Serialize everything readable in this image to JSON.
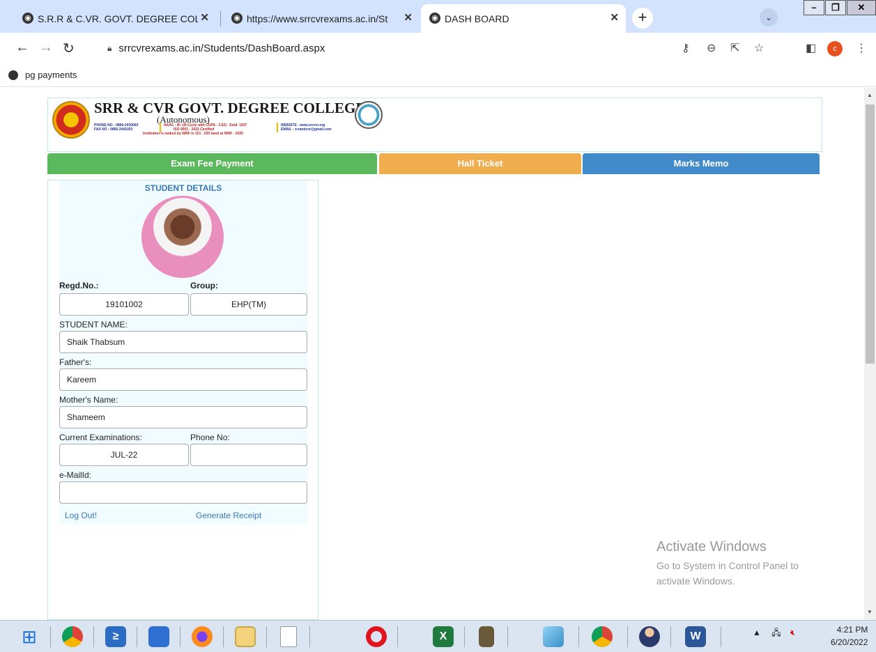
{
  "browser": {
    "tabs": [
      {
        "title": "S.R.R & C.VR. GOVT. DEGREE COL",
        "active": false
      },
      {
        "title": "https://www.srrcvrexams.ac.in/St",
        "active": false
      },
      {
        "title": "DASH BOARD",
        "active": true
      }
    ],
    "url": "srrcvrexams.ac.in/Students/DashBoard.aspx",
    "bookmark": "pg payments",
    "profile_initial": "c"
  },
  "header": {
    "college_name": "SRR & CVR GOVT. DEGREE COLLEGE",
    "subtitle": "(Autonomous)",
    "phone_line": "PHONE NO : 0866-2430060",
    "fax_line": "FAX NO     : 0866-2441003",
    "naac_line": "NAAC : B+ (III Cycle with CGPA : 2.62) - Estd: 1937",
    "iso_line": "ISO 9001 - 2015 Certified",
    "nirf_line": "Institution is ranked by NIRF in 151 - 200 band at NIRF - 2020",
    "website_line": "WEBSITE : www.srrcvr.org",
    "email_line": "EMAIL     : srrandcvr@gmail.com"
  },
  "nav": {
    "exam_fee": "Exam Fee Payment",
    "hall_ticket": "Hall Ticket",
    "marks_memo": "Marks Memo"
  },
  "student": {
    "panel_title": "STUDENT DETAILS",
    "regd_label": "Regd.No.:",
    "regd_value": "19101002",
    "group_label": "Group:",
    "group_value": "EHP(TM)",
    "name_label": "STUDENT NAME:",
    "name_value": "Shaik Thabsum",
    "father_label": "Father's:",
    "father_value": "Kareem",
    "mother_label": "Mother's Name:",
    "mother_value": "Shameem",
    "exam_label": "Current Examinations:",
    "exam_value": "JUL-22",
    "phone_label": "Phone No:",
    "phone_value": "",
    "email_label": "e-MailId:",
    "email_value": "",
    "logout": "Log Out!",
    "receipt": "Generate Receipt"
  },
  "watermark": {
    "line1": "Activate Windows",
    "line2": "Go to System in Control Panel to",
    "line3": "activate Windows."
  },
  "taskbar": {
    "time": "4:21 PM",
    "date": "6/20/2022"
  }
}
